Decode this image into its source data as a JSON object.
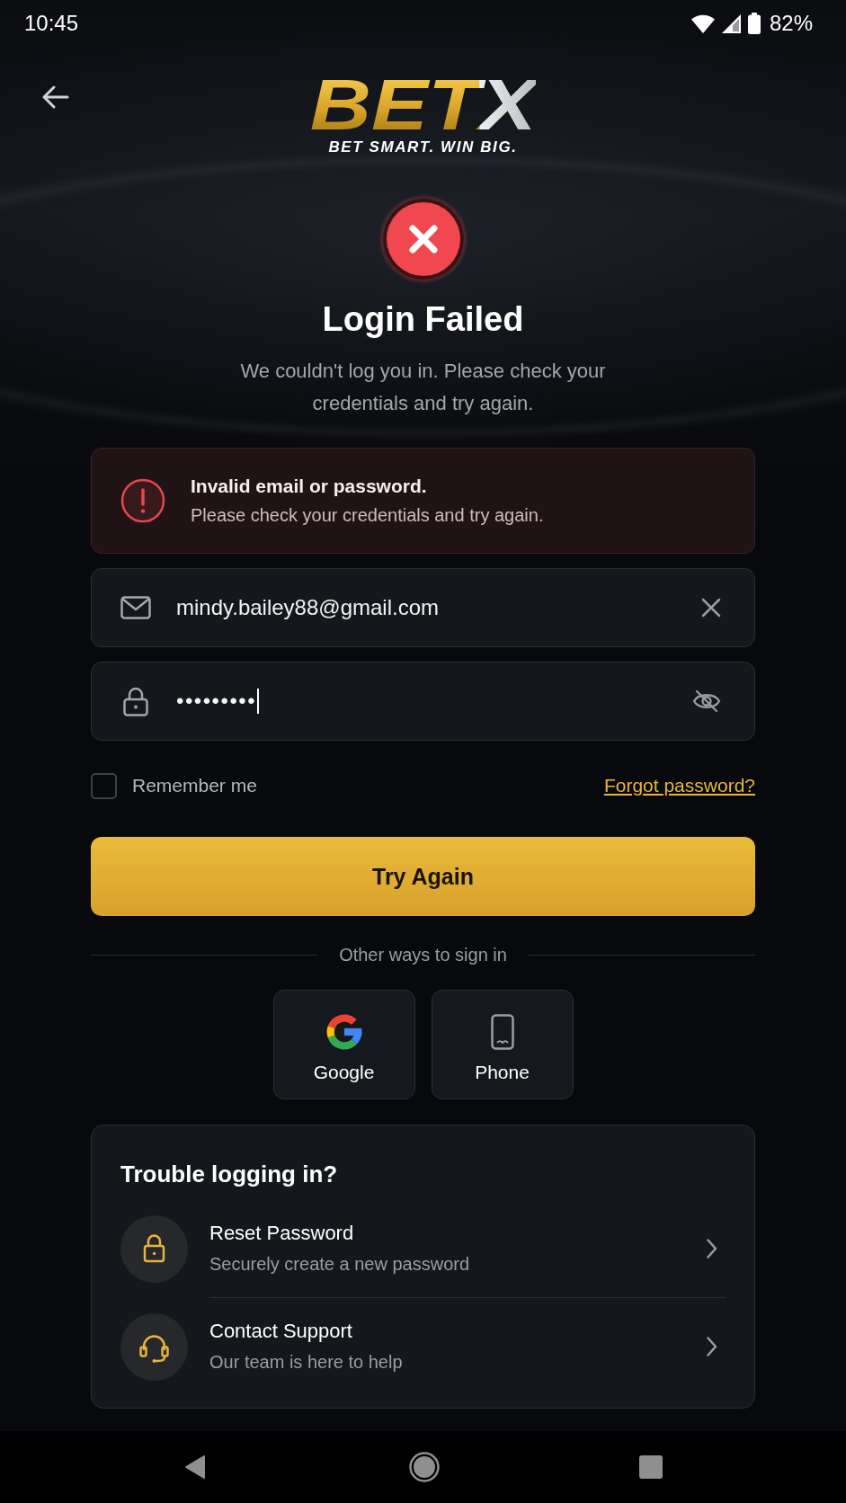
{
  "status_bar": {
    "time": "10:45",
    "battery": "82%"
  },
  "logo": {
    "wordmark": "BETX",
    "tagline": "BET SMART. WIN BIG."
  },
  "error": {
    "title": "Login Failed",
    "message": "We couldn't log you in. Please check your credentials and try again."
  },
  "alert": {
    "title": "Invalid email or password.",
    "message": "Please check your credentials and try again."
  },
  "form": {
    "email": {
      "value": "mindy.bailey88@gmail.com"
    },
    "password": {
      "value": "•••••••••",
      "focused": true
    },
    "remember_me": {
      "label": "Remember me",
      "checked": false
    },
    "forgot_password": "Forgot password?",
    "submit": "Try Again"
  },
  "alt_sign_in": {
    "label": "Other ways to sign in",
    "options": [
      {
        "kind": "google",
        "label": "Google"
      },
      {
        "kind": "phone",
        "label": "Phone"
      }
    ]
  },
  "help": {
    "title": "Trouble logging in?",
    "items": [
      {
        "kind": "lock",
        "title": "Reset Password",
        "subtitle": "Securely create a new password"
      },
      {
        "kind": "headset",
        "title": "Contact Support",
        "subtitle": "Our team is here to help"
      }
    ]
  }
}
